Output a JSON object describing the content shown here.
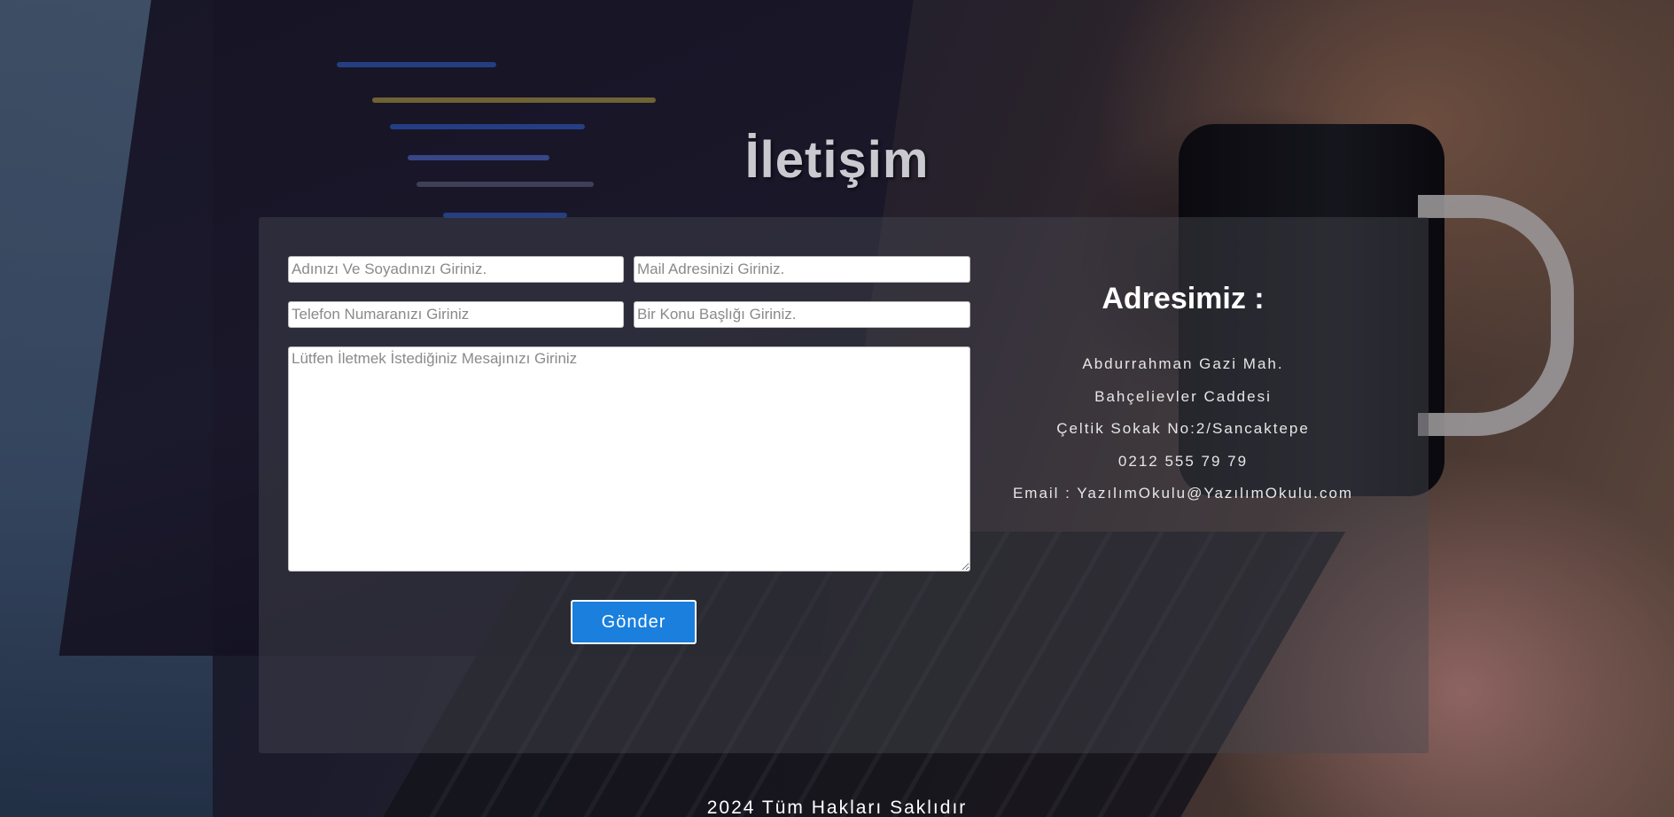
{
  "page": {
    "title": "İletişim"
  },
  "form": {
    "name_placeholder": "Adınızı Ve Soyadınızı Giriniz.",
    "email_placeholder": "Mail Adresinizi Giriniz.",
    "phone_placeholder": "Telefon Numaranızı Giriniz",
    "subject_placeholder": "Bir Konu Başlığı Giriniz.",
    "message_placeholder": "Lütfen İletmek İstediğiniz Mesajınızı Giriniz",
    "submit_label": "Gönder"
  },
  "address": {
    "heading": "Adresimiz :",
    "lines": [
      "Abdurrahman Gazi Mah.",
      "Bahçelievler Caddesi",
      "Çeltik Sokak No:2/Sancaktepe",
      "0212 555 79 79",
      "Email : YazılımOkulu@YazılımOkulu.com"
    ]
  },
  "footer": {
    "text": "2024 Tüm Hakları Saklıdır"
  },
  "colors": {
    "accent": "#1a7fdd",
    "panel": "rgba(70,70,80,0.45)"
  }
}
